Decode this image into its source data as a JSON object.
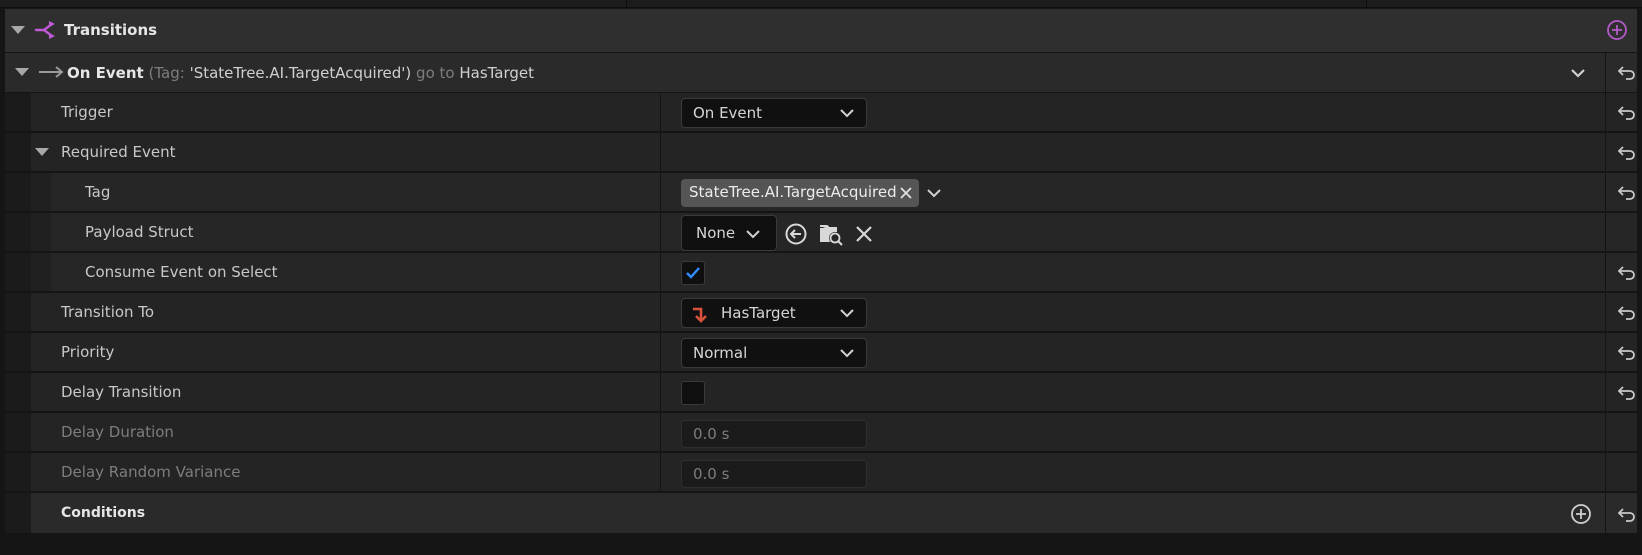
{
  "section": {
    "title": "Transitions"
  },
  "transition": {
    "prefix": "On Event",
    "paren_open": "(",
    "tag_key": "Tag:",
    "tag_value": " 'StateTree.AI.TargetAcquired')",
    "go_to": " go to ",
    "target": "HasTarget"
  },
  "rows": {
    "trigger": {
      "label": "Trigger",
      "value": "On Event"
    },
    "required_event": {
      "label": "Required Event"
    },
    "tag": {
      "label": "Tag",
      "value": "StateTree.AI.TargetAcquired"
    },
    "payload_struct": {
      "label": "Payload Struct",
      "value": "None"
    },
    "consume_event": {
      "label": "Consume Event on Select",
      "checked": true
    },
    "transition_to": {
      "label": "Transition To",
      "value": "HasTarget"
    },
    "priority": {
      "label": "Priority",
      "value": "Normal"
    },
    "delay_transition": {
      "label": "Delay Transition",
      "checked": false
    },
    "delay_duration": {
      "label": "Delay Duration",
      "value": "0.0 s"
    },
    "delay_random_variance": {
      "label": "Delay Random Variance",
      "value": "0.0 s"
    },
    "conditions": {
      "label": "Conditions"
    }
  },
  "colors": {
    "accent_purple": "#b45ac8",
    "transition_arrow": "#d8523c",
    "check_blue": "#2f8cff"
  },
  "icons": {
    "header": "transitions-icon",
    "add": "plus-circle-icon",
    "reset": "reset-arrow-icon",
    "expand": "chevron-down-icon"
  }
}
